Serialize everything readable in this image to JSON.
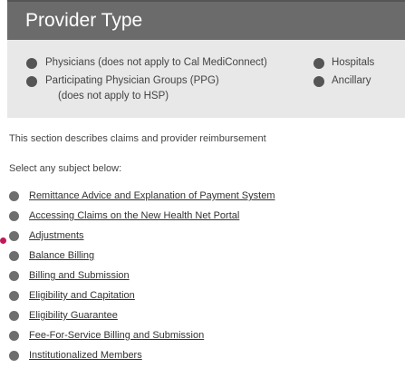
{
  "header": {
    "title": "Provider Type"
  },
  "provider_options": [
    {
      "label_line1": "Physicians (does not apply to Cal MediConnect)",
      "label_line2": ""
    },
    {
      "label_line1": "Participating Physician Groups (PPG)",
      "label_line2": "(does not apply to HSP)"
    },
    {
      "label_line1": "Hospitals",
      "label_line2": ""
    },
    {
      "label_line1": "Ancillary",
      "label_line2": ""
    }
  ],
  "section": {
    "description": "This section describes claims and provider reimbursement",
    "prompt": "Select any subject below:"
  },
  "subjects": [
    "Remittance Advice and Explanation of Payment System",
    "Accessing Claims on the New Health Net Portal",
    "Adjustments",
    "Balance Billing",
    "Billing and Submission",
    "Eligibility and Capitation",
    "Eligibility Guarantee",
    "Fee-For-Service Billing and Submission",
    "Institutionalized Members"
  ],
  "colors": {
    "header_bg": "#6b6b6b",
    "panel_bg": "#e8e8e8",
    "marker": "#c2185b"
  }
}
